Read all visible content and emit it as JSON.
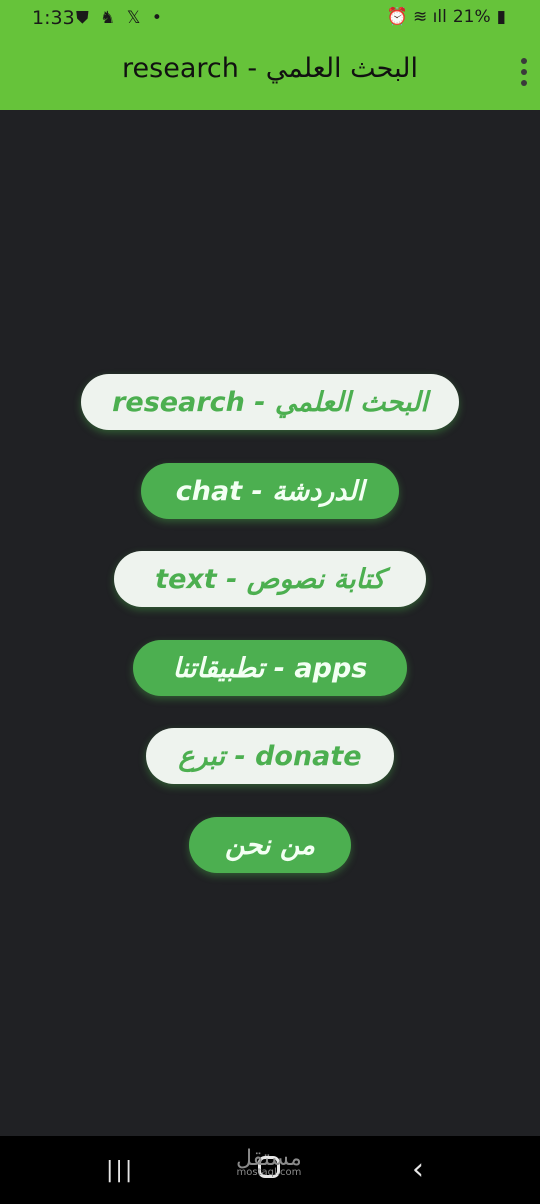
{
  "status_bar": {
    "time": "1:33",
    "notification_glyphs": "⛊ ♞ 𝕏 •",
    "battery": "21%",
    "right_glyphs": "⏰ ≋ ıll"
  },
  "app_bar": {
    "title": "research - البحث العلمي"
  },
  "buttons": [
    {
      "label": "research - البحث العلمي",
      "style": "light"
    },
    {
      "label": "chat - الدردشة",
      "style": "green"
    },
    {
      "label": "text - كتابة نصوص",
      "style": "light"
    },
    {
      "label": "تطبيقاتنا - apps",
      "style": "green"
    },
    {
      "label": "تبرع - donate",
      "style": "light"
    },
    {
      "label": "من نحن",
      "style": "green"
    }
  ],
  "nav_bar": {
    "recents": "|||",
    "back": "‹",
    "watermark": "مستقل",
    "watermark_sub": "mostaql.com"
  },
  "colors": {
    "accent": "#66c33a",
    "button_green": "#4caf50",
    "button_light": "#eef3ee",
    "background": "#202124"
  }
}
